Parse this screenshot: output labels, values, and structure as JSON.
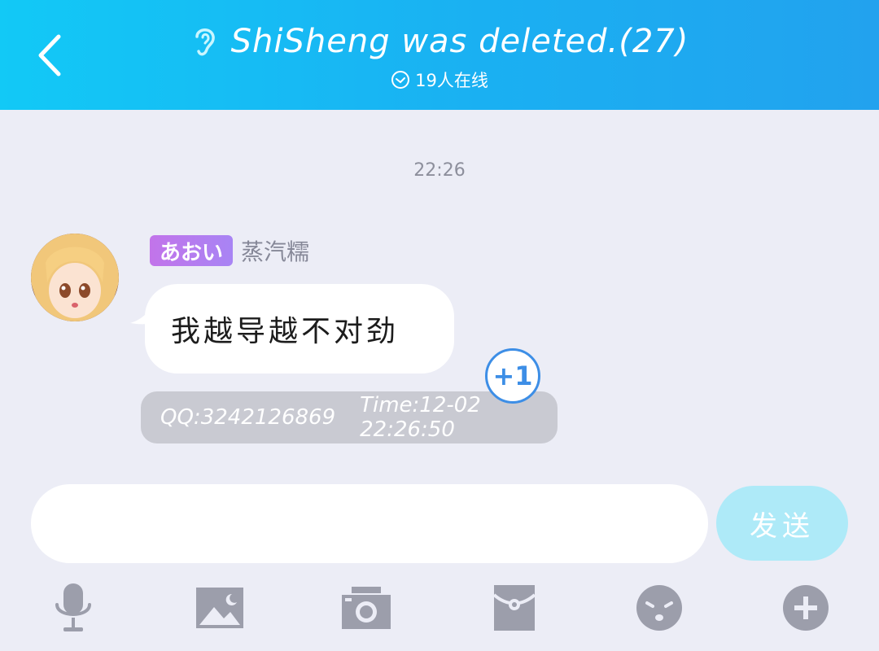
{
  "header": {
    "title": "ShiSheng was deleted.(27)",
    "online": "19人在线",
    "ear_icon": "ear-icon",
    "back_icon": "chevron-left-icon",
    "status_icon": "check-circle-icon"
  },
  "chat": {
    "timestamp": "22:26",
    "messages": [
      {
        "badge": "あおい",
        "sender": "蒸汽糯",
        "text": "我越导越不对劲",
        "plus_one": "+1",
        "qq": "QQ:3242126869",
        "time": "Time:12-02 22:26:50"
      }
    ]
  },
  "input": {
    "value": "",
    "placeholder": "",
    "send_label": "发送"
  },
  "toolbar": [
    "microphone-icon",
    "image-icon",
    "camera-icon",
    "red-packet-icon",
    "emoji-icon",
    "plus-icon"
  ],
  "colors": {
    "header_start": "#12c9f6",
    "header_end": "#22a2ee",
    "background": "#ecedf6",
    "badge": "#b87cee",
    "plus_one": "#3d8ee6",
    "send_button": "#aeeaf8",
    "toolbar_icon": "#9c9eab"
  }
}
